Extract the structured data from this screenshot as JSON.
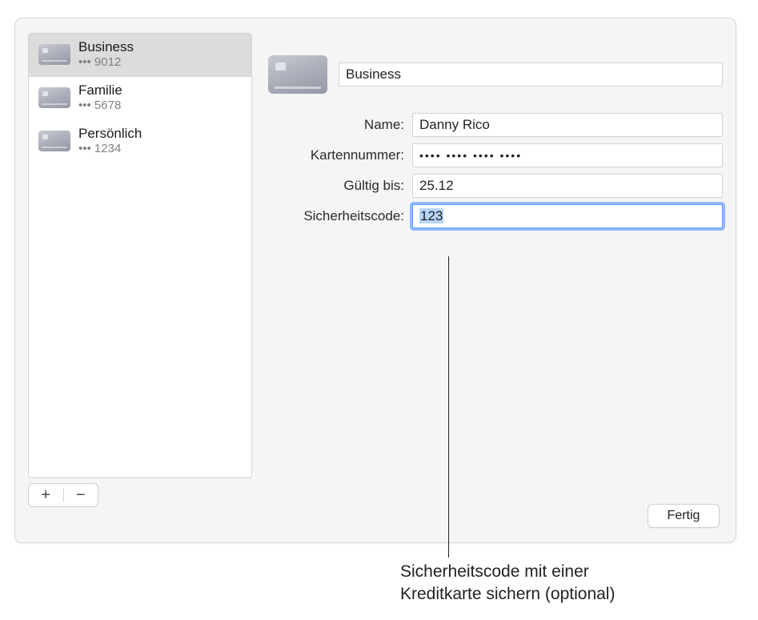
{
  "sidebar": {
    "items": [
      {
        "title": "Business",
        "sub": "••• 9012"
      },
      {
        "title": "Familie",
        "sub": "••• 5678"
      },
      {
        "title": "Persönlich",
        "sub": "••• 1234"
      }
    ]
  },
  "detail": {
    "title_value": "Business",
    "rows": {
      "name": {
        "label": "Name:",
        "value": "Danny Rico"
      },
      "card_number": {
        "label": "Kartennummer:",
        "value": "•••• •••• •••• ••••"
      },
      "expiry": {
        "label": "Gültig bis:",
        "value": "25.12"
      },
      "cvc": {
        "label": "Sicherheitscode:",
        "value": "123"
      }
    }
  },
  "buttons": {
    "add": "+",
    "remove": "−",
    "done": "Fertig"
  },
  "callout": "Sicherheitscode mit einer\nKreditkarte sichern (optional)"
}
